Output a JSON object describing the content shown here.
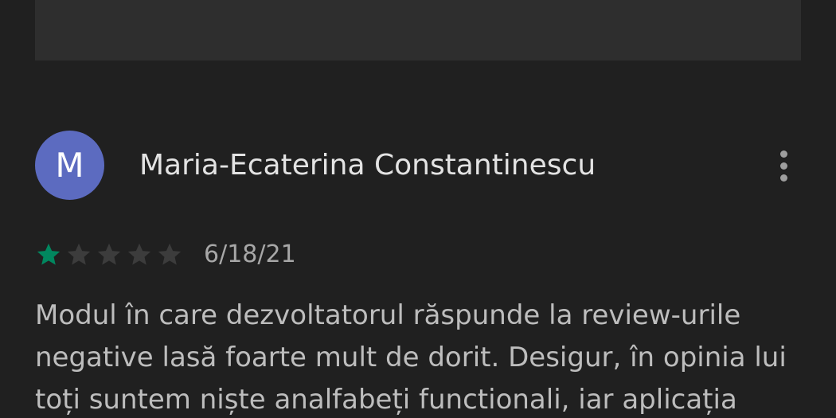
{
  "review": {
    "avatar_letter": "M",
    "avatar_color": "#5c6bc0",
    "reviewer_name": "Maria-Ecaterina Constantinescu",
    "more_icon": "more-vert-icon",
    "rating": 1,
    "max_rating": 5,
    "star_filled_color": "#01875f",
    "star_empty_color": "#3c3c3c",
    "date": "6/18/21",
    "text": "Modul în care dezvoltatorul răspunde la review-urile negative lasă foarte mult de dorit. Desigur, în opinia lui toți suntem niște analfabeți functionali, iar aplicația"
  }
}
